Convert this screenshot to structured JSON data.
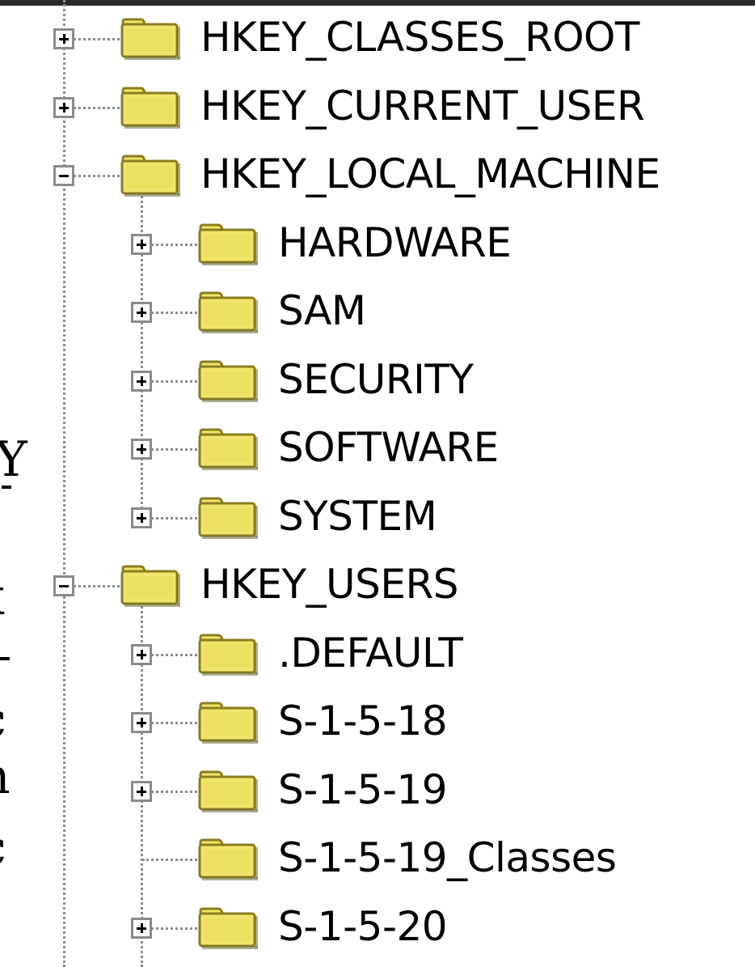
{
  "tree": {
    "nodes": [
      {
        "label": "HKEY_CLASSES_ROOT",
        "depth": 0,
        "state": "collapsed"
      },
      {
        "label": "HKEY_CURRENT_USER",
        "depth": 0,
        "state": "collapsed"
      },
      {
        "label": "HKEY_LOCAL_MACHINE",
        "depth": 0,
        "state": "expanded"
      },
      {
        "label": "HARDWARE",
        "depth": 1,
        "state": "collapsed"
      },
      {
        "label": "SAM",
        "depth": 1,
        "state": "collapsed"
      },
      {
        "label": "SECURITY",
        "depth": 1,
        "state": "collapsed"
      },
      {
        "label": "SOFTWARE",
        "depth": 1,
        "state": "collapsed"
      },
      {
        "label": "SYSTEM",
        "depth": 1,
        "state": "collapsed"
      },
      {
        "label": "HKEY_USERS",
        "depth": 0,
        "state": "expanded"
      },
      {
        "label": ".DEFAULT",
        "depth": 1,
        "state": "collapsed"
      },
      {
        "label": "S-1-5-18",
        "depth": 1,
        "state": "collapsed"
      },
      {
        "label": "S-1-5-19",
        "depth": 1,
        "state": "collapsed"
      },
      {
        "label": "S-1-5-19_Classes",
        "depth": 1,
        "state": "leaf"
      },
      {
        "label": "S-1-5-20",
        "depth": 1,
        "state": "collapsed"
      }
    ]
  },
  "icons": {
    "folder": "folder-icon",
    "expand": "plus-box-icon",
    "collapse": "minus-box-icon"
  },
  "colors": {
    "folder_fill": "#f2e46a",
    "folder_edge": "#8a7d1e",
    "tree_line": "#8c8c8c",
    "expander_border": "#8a8a8a"
  }
}
